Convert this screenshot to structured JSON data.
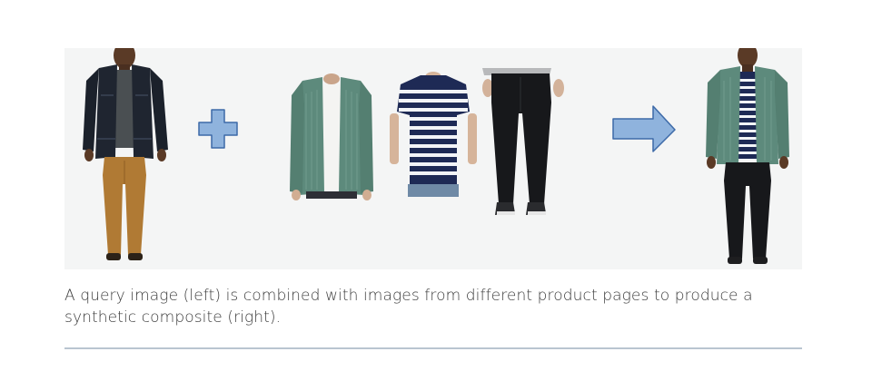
{
  "figure": {
    "caption": "A query image (left) is combined with images from different product pages to produce a synthetic composite (right).",
    "icons": [
      "plus-icon",
      "right-arrow-icon"
    ],
    "colors": {
      "panel_background": "#f4f5f5",
      "icon_fill": "#8fb3dd",
      "icon_stroke": "#3d6aa8",
      "divider": "#b9c5d0",
      "caption_text": "#3c3c3c"
    }
  }
}
